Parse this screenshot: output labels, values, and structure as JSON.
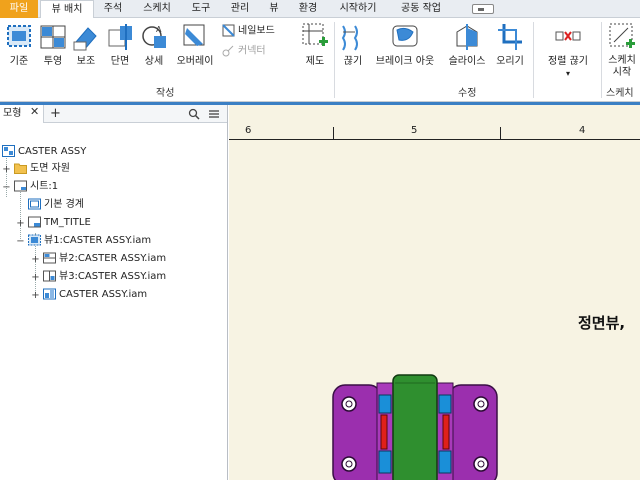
{
  "menu": {
    "tabs": [
      "파일",
      "뷰 배치",
      "주석",
      "스케치",
      "도구",
      "관리",
      "뷰",
      "환경",
      "시작하기",
      "공동 작업"
    ],
    "active_index": 1
  },
  "ribbon": {
    "create": {
      "buttons": [
        "기준",
        "투영",
        "보조",
        "단면",
        "상세",
        "오버레이"
      ],
      "small": [
        "네일보드",
        "커넥터"
      ],
      "draft": "제도",
      "label": "작성"
    },
    "modify": {
      "buttons": [
        "끊기",
        "브레이크 아웃",
        "슬라이스",
        "오리기"
      ],
      "label": "수정"
    },
    "align": {
      "label": "정렬 끊기"
    },
    "sketch": {
      "label_line1": "스케치",
      "label_line2": "시작",
      "panel": "스케치"
    }
  },
  "browser": {
    "tab_label": "모형",
    "tree": [
      {
        "label": "CASTER ASSY",
        "toggle": ""
      },
      {
        "label": "도면 자원",
        "toggle": "+"
      },
      {
        "label": "시트:1",
        "toggle": "−"
      },
      {
        "label": "기본 경계",
        "toggle": ""
      },
      {
        "label": "TM_TITLE",
        "toggle": "+"
      },
      {
        "label": "뷰1:CASTER ASSY.iam",
        "toggle": "−"
      },
      {
        "label": "뷰2:CASTER ASSY.iam",
        "toggle": "+"
      },
      {
        "label": "뷰3:CASTER ASSY.iam",
        "toggle": "+"
      },
      {
        "label": "CASTER ASSY.iam",
        "toggle": "+"
      }
    ]
  },
  "canvas": {
    "ruler": [
      "6",
      "5",
      "4"
    ],
    "view_label": "정면뷰,"
  },
  "colors": {
    "file_tab": "#f0a21c",
    "accent_strip": "#3b7fc4",
    "sheet_bg": "#f7f3e3",
    "part_purple": "#9b2fae",
    "part_green": "#2f8f2f",
    "part_blue": "#1a8fd8",
    "part_red": "#e0201a"
  }
}
